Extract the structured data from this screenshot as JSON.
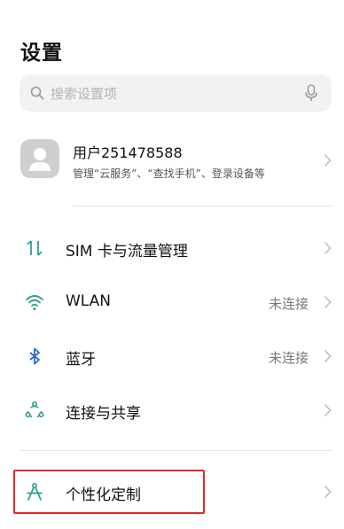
{
  "header": {
    "title": "设置"
  },
  "search": {
    "placeholder": "搜索设置项"
  },
  "account": {
    "name": "用户251478588",
    "subtitle": "管理“云服务”、“查找手机”、登录设备等"
  },
  "settings_items": [
    {
      "label": "SIM 卡与流量管理",
      "value": "",
      "icon": "sim-data-icon"
    },
    {
      "label": "WLAN",
      "value": "未连接",
      "icon": "wifi-icon"
    },
    {
      "label": "蓝牙",
      "value": "未连接",
      "icon": "bluetooth-icon"
    },
    {
      "label": "连接与共享",
      "value": "",
      "icon": "connection-share-icon"
    },
    {
      "label": "个性化定制",
      "value": "",
      "icon": "personalization-icon"
    }
  ],
  "colors": {
    "accent": "#2f9e8f",
    "bluetooth": "#2a6ad1",
    "highlight": "#e02828"
  }
}
